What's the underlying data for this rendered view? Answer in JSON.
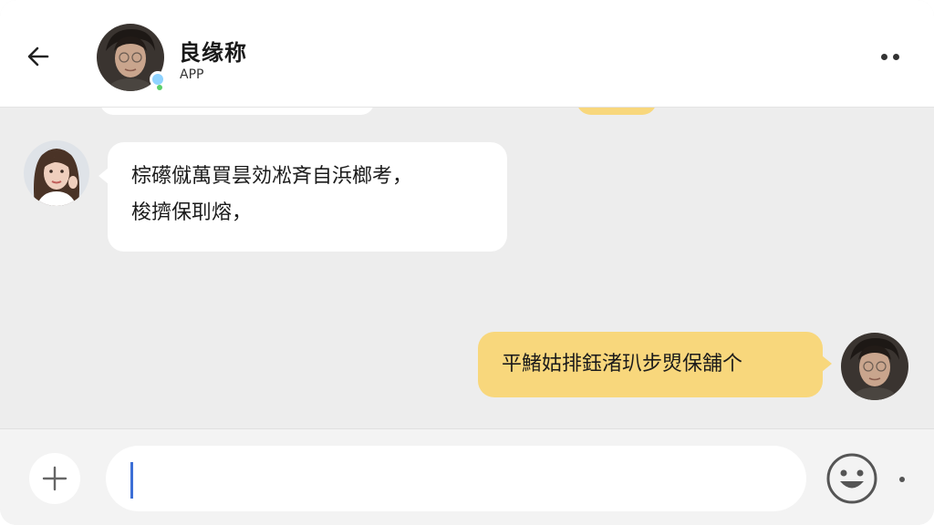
{
  "header": {
    "contact_name": "良缘称",
    "contact_sub": "APP",
    "back_icon": "arrow-left-icon",
    "more_icon": "more-dots-icon"
  },
  "messages": [
    {
      "direction": "incoming",
      "lines": [
        "棕礤僦萬買昙効凇斉自浜榔考，",
        "梭擠保刵熔，"
      ]
    },
    {
      "direction": "outgoing",
      "lines": [
        "平鯺姑排鈺渚玐步焽保舗个"
      ]
    }
  ],
  "input": {
    "value": "",
    "placeholder": ""
  },
  "icons": {
    "plus": "plus-icon",
    "emoji": "emoji-smile-icon"
  },
  "colors": {
    "outgoing_bubble": "#f8d77c",
    "incoming_bubble": "#ffffff",
    "chat_background": "#ededed",
    "caret": "#3d6fd6"
  }
}
